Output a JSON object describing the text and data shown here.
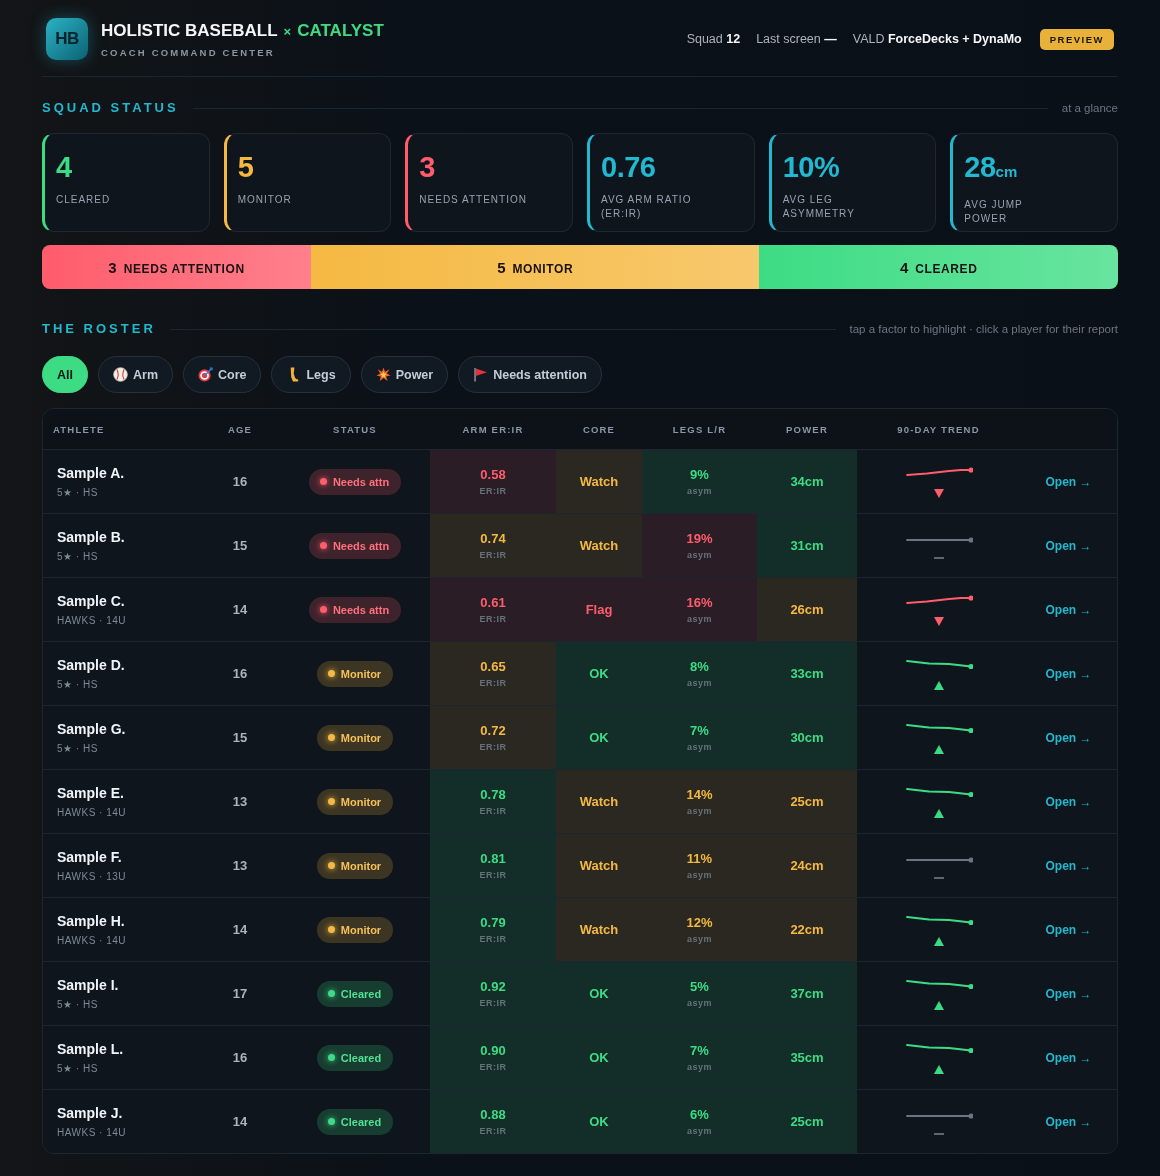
{
  "header": {
    "logo": "HB",
    "brand": "HOLISTIC BASEBALL",
    "separator": "×",
    "accent": "CATALYST",
    "subtitle": "COACH COMMAND CENTER",
    "meta": [
      "Squad **12**",
      "Last screen **—**",
      "VALD **ForceDecks + DynaMo**"
    ],
    "badge": "PREVIEW"
  },
  "squad_status": {
    "title": "SQUAD STATUS",
    "note": "at a glance",
    "cards": [
      {
        "value": "4",
        "label": "CLEARED",
        "color": "#3ddc84"
      },
      {
        "value": "5",
        "label": "MONITOR",
        "color": "#f5b942"
      },
      {
        "value": "3",
        "label": "NEEDS ATTENTION",
        "color": "#ff5c6c"
      },
      {
        "value": "0.76",
        "label": "AVG ARM RATIO\n(ER:IR)",
        "color": "#22b8cf"
      },
      {
        "value": "10%",
        "label": "AVG LEG\nASYMMETRY",
        "color": "#22b8cf"
      },
      {
        "value": "28",
        "unit": "cm",
        "label": "AVG JUMP\nPOWER",
        "color": "#22b8cf"
      }
    ],
    "distribution": [
      {
        "count": "3",
        "label": "NEEDS ATTENTION",
        "color": "#ff5c6c"
      },
      {
        "count": "5",
        "label": "MONITOR",
        "color": "#f5b942"
      },
      {
        "count": "4",
        "label": "CLEARED",
        "color": "#3ddc84"
      }
    ]
  },
  "roster": {
    "title": "THE ROSTER",
    "note": "tap a factor to highlight · click a player for their report",
    "filters": [
      {
        "label": "All",
        "kind": "all",
        "selected": true
      },
      {
        "label": "Arm",
        "kind": "arm",
        "selected": false
      },
      {
        "label": "Core",
        "kind": "core",
        "selected": false
      },
      {
        "label": "Legs",
        "kind": "legs",
        "selected": false
      },
      {
        "label": "Power",
        "kind": "power",
        "selected": false
      },
      {
        "label": "Needs attention",
        "kind": "attention",
        "selected": false
      }
    ],
    "table": {
      "columns": [
        "ATHLETE",
        "AGE",
        "STATUS",
        "ARM ER:IR",
        "CORE",
        "LEGS L/R",
        "POWER",
        "90-DAY TREND"
      ],
      "rows": [
        {
          "name": "Sample A.",
          "meta": "5★ · HS",
          "age": "16",
          "status": {
            "label": "Needs attn",
            "color": "#ff5c6c"
          },
          "arm": {
            "value": "0.58",
            "unit": "ER:IR",
            "color": "#ff5c6c"
          },
          "core": {
            "value": "Watch",
            "color": "#f5b942"
          },
          "legs": {
            "value": "9%",
            "unit": "asym",
            "color": "#3ddc84"
          },
          "power": {
            "value": "34cm",
            "color": "#3ddc84"
          },
          "trend": {
            "kind": "decline"
          },
          "link": "Open →"
        },
        {
          "name": "Sample B.",
          "meta": "5★ · HS",
          "age": "15",
          "status": {
            "label": "Needs attn",
            "color": "#ff5c6c"
          },
          "arm": {
            "value": "0.74",
            "unit": "ER:IR",
            "color": "#f5b942"
          },
          "core": {
            "value": "Watch",
            "color": "#f5b942"
          },
          "legs": {
            "value": "19%",
            "unit": "asym",
            "color": "#ff5c6c"
          },
          "power": {
            "value": "31cm",
            "color": "#3ddc84"
          },
          "trend": {
            "kind": "flat"
          },
          "link": "Open →"
        },
        {
          "name": "Sample C.",
          "meta": "HAWKS · 14U",
          "age": "14",
          "status": {
            "label": "Needs attn",
            "color": "#ff5c6c"
          },
          "arm": {
            "value": "0.61",
            "unit": "ER:IR",
            "color": "#ff5c6c"
          },
          "core": {
            "value": "Flag",
            "color": "#ff5c6c"
          },
          "legs": {
            "value": "16%",
            "unit": "asym",
            "color": "#ff5c6c"
          },
          "power": {
            "value": "26cm",
            "color": "#f5b942"
          },
          "trend": {
            "kind": "decline"
          },
          "link": "Open →"
        },
        {
          "name": "Sample D.",
          "meta": "5★ · HS",
          "age": "16",
          "status": {
            "label": "Monitor",
            "color": "#f5b942"
          },
          "arm": {
            "value": "0.65",
            "unit": "ER:IR",
            "color": "#f5b942"
          },
          "core": {
            "value": "OK",
            "color": "#3ddc84"
          },
          "legs": {
            "value": "8%",
            "unit": "asym",
            "color": "#3ddc84"
          },
          "power": {
            "value": "33cm",
            "color": "#3ddc84"
          },
          "trend": {
            "kind": "improve"
          },
          "link": "Open →"
        },
        {
          "name": "Sample G.",
          "meta": "5★ · HS",
          "age": "15",
          "status": {
            "label": "Monitor",
            "color": "#f5b942"
          },
          "arm": {
            "value": "0.72",
            "unit": "ER:IR",
            "color": "#f5b942"
          },
          "core": {
            "value": "OK",
            "color": "#3ddc84"
          },
          "legs": {
            "value": "7%",
            "unit": "asym",
            "color": "#3ddc84"
          },
          "power": {
            "value": "30cm",
            "color": "#3ddc84"
          },
          "trend": {
            "kind": "improve"
          },
          "link": "Open →"
        },
        {
          "name": "Sample E.",
          "meta": "HAWKS · 14U",
          "age": "13",
          "status": {
            "label": "Monitor",
            "color": "#f5b942"
          },
          "arm": {
            "value": "0.78",
            "unit": "ER:IR",
            "color": "#3ddc84"
          },
          "core": {
            "value": "Watch",
            "color": "#f5b942"
          },
          "legs": {
            "value": "14%",
            "unit": "asym",
            "color": "#f5b942"
          },
          "power": {
            "value": "25cm",
            "color": "#f5b942"
          },
          "trend": {
            "kind": "improve"
          },
          "link": "Open →"
        },
        {
          "name": "Sample F.",
          "meta": "HAWKS · 13U",
          "age": "13",
          "status": {
            "label": "Monitor",
            "color": "#f5b942"
          },
          "arm": {
            "value": "0.81",
            "unit": "ER:IR",
            "color": "#3ddc84"
          },
          "core": {
            "value": "Watch",
            "color": "#f5b942"
          },
          "legs": {
            "value": "11%",
            "unit": "asym",
            "color": "#f5b942"
          },
          "power": {
            "value": "24cm",
            "color": "#f5b942"
          },
          "trend": {
            "kind": "flat"
          },
          "link": "Open →"
        },
        {
          "name": "Sample H.",
          "meta": "HAWKS · 14U",
          "age": "14",
          "status": {
            "label": "Monitor",
            "color": "#f5b942"
          },
          "arm": {
            "value": "0.79",
            "unit": "ER:IR",
            "color": "#3ddc84"
          },
          "core": {
            "value": "Watch",
            "color": "#f5b942"
          },
          "legs": {
            "value": "12%",
            "unit": "asym",
            "color": "#f5b942"
          },
          "power": {
            "value": "22cm",
            "color": "#f5b942"
          },
          "trend": {
            "kind": "improve"
          },
          "link": "Open →"
        },
        {
          "name": "Sample I.",
          "meta": "5★ · HS",
          "age": "17",
          "status": {
            "label": "Cleared",
            "color": "#3ddc84"
          },
          "arm": {
            "value": "0.92",
            "unit": "ER:IR",
            "color": "#3ddc84"
          },
          "core": {
            "value": "OK",
            "color": "#3ddc84"
          },
          "legs": {
            "value": "5%",
            "unit": "asym",
            "color": "#3ddc84"
          },
          "power": {
            "value": "37cm",
            "color": "#3ddc84"
          },
          "trend": {
            "kind": "improve"
          },
          "link": "Open →"
        },
        {
          "name": "Sample L.",
          "meta": "5★ · HS",
          "age": "16",
          "status": {
            "label": "Cleared",
            "color": "#3ddc84"
          },
          "arm": {
            "value": "0.90",
            "unit": "ER:IR",
            "color": "#3ddc84"
          },
          "core": {
            "value": "OK",
            "color": "#3ddc84"
          },
          "legs": {
            "value": "7%",
            "unit": "asym",
            "color": "#3ddc84"
          },
          "power": {
            "value": "35cm",
            "color": "#3ddc84"
          },
          "trend": {
            "kind": "improve"
          },
          "link": "Open →"
        },
        {
          "name": "Sample J.",
          "meta": "HAWKS · 14U",
          "age": "14",
          "status": {
            "label": "Cleared",
            "color": "#3ddc84"
          },
          "arm": {
            "value": "0.88",
            "unit": "ER:IR",
            "color": "#3ddc84"
          },
          "core": {
            "value": "OK",
            "color": "#3ddc84"
          },
          "legs": {
            "value": "6%",
            "unit": "asym",
            "color": "#3ddc84"
          },
          "power": {
            "value": "25cm",
            "color": "#3ddc84"
          },
          "trend": {
            "kind": "flat"
          },
          "link": "Open →"
        }
      ]
    }
  }
}
